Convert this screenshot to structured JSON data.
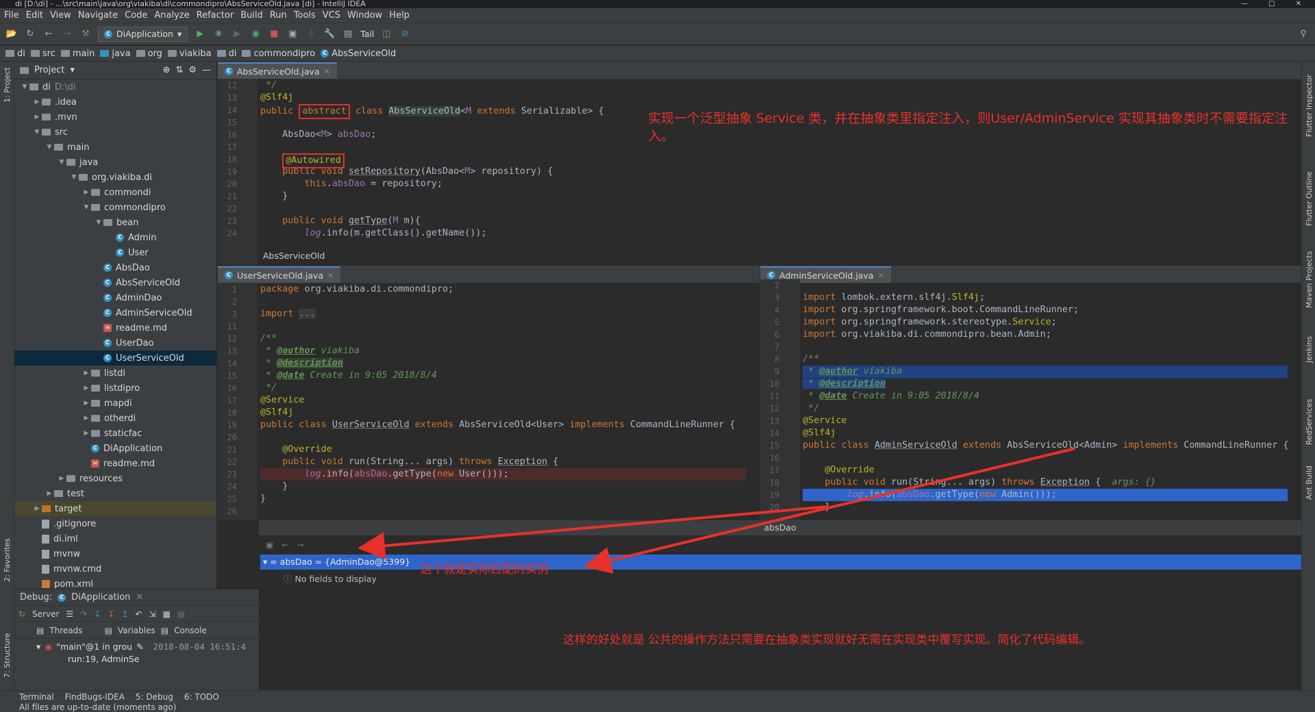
{
  "window": {
    "title": "di [D:\\di] - ...\\src\\main\\java\\org\\viakiba\\di\\commondipro\\AbsServiceOld.java [di] - IntelliJ IDEA"
  },
  "menu": [
    "File",
    "Edit",
    "View",
    "Navigate",
    "Code",
    "Analyze",
    "Refactor",
    "Build",
    "Run",
    "Tools",
    "VCS",
    "Window",
    "Help"
  ],
  "toolbar": {
    "run_config": "DiApplication",
    "tail": "Tail"
  },
  "breadcrumb": [
    "di",
    "src",
    "main",
    "java",
    "org",
    "viakiba",
    "di",
    "commondipro",
    "AbsServiceOld"
  ],
  "project": {
    "header": "Project",
    "tree": [
      {
        "label": "di",
        "extra": "D:\\di",
        "depth": 0,
        "arrow": "down",
        "icon": "folder"
      },
      {
        "label": ".idea",
        "depth": 1,
        "arrow": "right",
        "icon": "folder"
      },
      {
        "label": ".mvn",
        "depth": 1,
        "arrow": "right",
        "icon": "folder"
      },
      {
        "label": "src",
        "depth": 1,
        "arrow": "down",
        "icon": "folder"
      },
      {
        "label": "main",
        "depth": 2,
        "arrow": "down",
        "icon": "folder"
      },
      {
        "label": "java",
        "depth": 3,
        "arrow": "down",
        "icon": "folder"
      },
      {
        "label": "org.viakiba.di",
        "depth": 4,
        "arrow": "down",
        "icon": "folder"
      },
      {
        "label": "commondi",
        "depth": 5,
        "arrow": "right",
        "icon": "folder"
      },
      {
        "label": "commondipro",
        "depth": 5,
        "arrow": "down",
        "icon": "folder"
      },
      {
        "label": "bean",
        "depth": 6,
        "arrow": "down",
        "icon": "folder"
      },
      {
        "label": "Admin",
        "depth": 7,
        "icon": "class"
      },
      {
        "label": "User",
        "depth": 7,
        "icon": "class"
      },
      {
        "label": "AbsDao",
        "depth": 6,
        "icon": "class"
      },
      {
        "label": "AbsServiceOld",
        "depth": 6,
        "icon": "class"
      },
      {
        "label": "AdminDao",
        "depth": 6,
        "icon": "class"
      },
      {
        "label": "AdminServiceOld",
        "depth": 6,
        "icon": "class"
      },
      {
        "label": "readme.md",
        "depth": 6,
        "icon": "md"
      },
      {
        "label": "UserDao",
        "depth": 6,
        "icon": "class"
      },
      {
        "label": "UserServiceOld",
        "depth": 6,
        "icon": "class",
        "selected": true
      },
      {
        "label": "listdi",
        "depth": 5,
        "arrow": "right",
        "icon": "folder"
      },
      {
        "label": "listdipro",
        "depth": 5,
        "arrow": "right",
        "icon": "folder"
      },
      {
        "label": "mapdi",
        "depth": 5,
        "arrow": "right",
        "icon": "folder"
      },
      {
        "label": "otherdi",
        "depth": 5,
        "arrow": "right",
        "icon": "folder"
      },
      {
        "label": "staticfac",
        "depth": 5,
        "arrow": "right",
        "icon": "folder"
      },
      {
        "label": "DiApplication",
        "depth": 5,
        "icon": "class"
      },
      {
        "label": "readme.md",
        "depth": 5,
        "icon": "md"
      },
      {
        "label": "resources",
        "depth": 3,
        "arrow": "right",
        "icon": "folder"
      },
      {
        "label": "test",
        "depth": 2,
        "arrow": "right",
        "icon": "folder"
      },
      {
        "label": "target",
        "depth": 1,
        "arrow": "right",
        "icon": "folder",
        "target": true
      },
      {
        "label": ".gitignore",
        "depth": 1,
        "icon": "file"
      },
      {
        "label": "di.iml",
        "depth": 1,
        "icon": "file"
      },
      {
        "label": "mvnw",
        "depth": 1,
        "icon": "file"
      },
      {
        "label": "mvnw.cmd",
        "depth": 1,
        "icon": "file"
      },
      {
        "label": "pom.xml",
        "depth": 1,
        "icon": "xml"
      }
    ]
  },
  "top_editor": {
    "tab": "AbsServiceOld.java",
    "breadcrumb": "AbsServiceOld",
    "note": "实现一个泛型抽象 Service 类，并在抽象类里指定注入，则User/AdminService 实现其抽象类时不需要指定注入。"
  },
  "left_editor": {
    "tab": "UserServiceOld.java"
  },
  "right_editor": {
    "tab": "AdminServiceOld.java"
  },
  "debug_vars": {
    "title": "absDao",
    "row": "absDao = {AdminDao@5399}",
    "empty": "No fields to display",
    "note_instance": "这个就是实际匹配的实例",
    "note_benefit": "这样的好处就是 公共的操作方法只需要在抽象类实现就好无需在实现类中覆写实现。简化了代码编辑。"
  },
  "debug_panel": {
    "label": "Debug:",
    "config": "DiApplication",
    "server": "Server",
    "threads": "Threads",
    "variables": "Variables",
    "console": "Console",
    "thread": "\"main\"@1 in grou",
    "frame": "run:19, AdminSe",
    "timestamp": "2018-08-04 16:51:4"
  },
  "bottom_tabs": [
    "Terminal",
    "FindBugs-IDEA",
    "5: Debug",
    "6: TODO"
  ],
  "status": "All files are up-to-date (moments ago)",
  "side_left": [
    "1: Project",
    "2: Favorites",
    "7: Structure"
  ],
  "side_right": [
    "Flutter Inspector",
    "Flutter Outline",
    "Maven Projects",
    "Jenkins",
    "RedServices",
    "Ant Build"
  ]
}
